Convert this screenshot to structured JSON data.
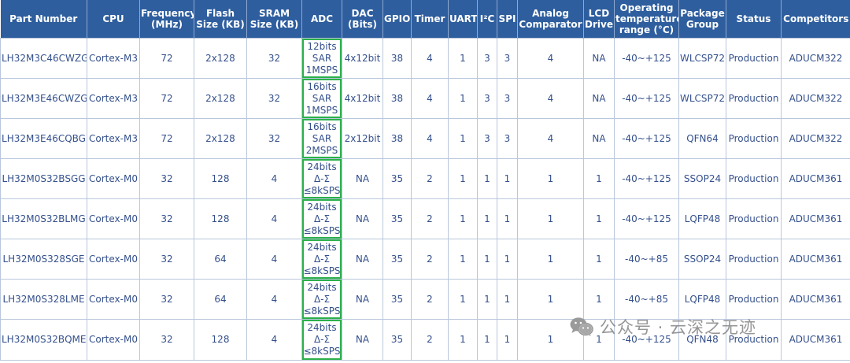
{
  "table": {
    "headers": [
      "Part Number",
      "CPU",
      "Frequency (MHz)",
      "Flash Size (KB)",
      "SRAM Size (KB)",
      "ADC",
      "DAC (Bits)",
      "GPIO",
      "Timer",
      "UART",
      "I²C",
      "SPI",
      "Analog Comparator",
      "LCD Driver",
      "Operating temperature range (°C)",
      "Package Group",
      "Status",
      "Competitors"
    ],
    "rows": [
      [
        "LH32M3C46CWZG",
        "Cortex-M3",
        "72",
        "2x128",
        "32",
        [
          "12bits",
          "SAR",
          "1MSPS"
        ],
        "4x12bit",
        "38",
        "4",
        "1",
        "3",
        "3",
        "4",
        "NA",
        "-40~+125",
        "WLCSP72",
        "Production",
        "ADUCM322"
      ],
      [
        "LH32M3E46CWZG",
        "Cortex-M3",
        "72",
        "2x128",
        "32",
        [
          "16bits",
          "SAR",
          "1MSPS"
        ],
        "4x12bit",
        "38",
        "4",
        "1",
        "3",
        "3",
        "4",
        "NA",
        "-40~+125",
        "WLCSP72",
        "Production",
        "ADUCM322"
      ],
      [
        "LH32M3E46CQBG",
        "Cortex-M3",
        "72",
        "2x128",
        "32",
        [
          "16bits",
          "SAR",
          "2MSPS"
        ],
        "2x12bit",
        "38",
        "4",
        "1",
        "3",
        "3",
        "4",
        "NA",
        "-40~+125",
        "QFN64",
        "Production",
        "ADUCM322"
      ],
      [
        "LH32M0S32BSGG",
        "Cortex-M0",
        "32",
        "128",
        "4",
        [
          "24bits",
          "Δ-Σ",
          "≤8kSPS"
        ],
        "NA",
        "35",
        "2",
        "1",
        "1",
        "1",
        "1",
        "1",
        "-40~+125",
        "SSOP24",
        "Production",
        "ADUCM361"
      ],
      [
        "LH32M0S32BLMG",
        "Cortex-M0",
        "32",
        "128",
        "4",
        [
          "24bits",
          "Δ-Σ",
          "≤8kSPS"
        ],
        "NA",
        "35",
        "2",
        "1",
        "1",
        "1",
        "1",
        "1",
        "-40~+125",
        "LQFP48",
        "Production",
        "ADUCM361"
      ],
      [
        "LH32M0S328SGE",
        "Cortex-M0",
        "32",
        "64",
        "4",
        [
          "24bits",
          "Δ-Σ",
          "≤8kSPS"
        ],
        "NA",
        "35",
        "2",
        "1",
        "1",
        "1",
        "1",
        "1",
        "-40~+85",
        "SSOP24",
        "Production",
        "ADUCM361"
      ],
      [
        "LH32M0S328LME",
        "Cortex-M0",
        "32",
        "64",
        "4",
        [
          "24bits",
          "Δ-Σ",
          "≤8kSPS"
        ],
        "NA",
        "35",
        "2",
        "1",
        "1",
        "1",
        "1",
        "1",
        "-40~+85",
        "LQFP48",
        "Production",
        "ADUCM361"
      ],
      [
        "LH32M0S32BQME",
        "Cortex-M0",
        "32",
        "128",
        "4",
        [
          "24bits",
          "Δ-Σ",
          "≤8kSPS"
        ],
        "NA",
        "35",
        "2",
        "1",
        "1",
        "1",
        "1",
        "1",
        "-40~+125",
        "QFN48",
        "Production",
        "ADUCM361"
      ]
    ],
    "highlighted_column": "ADC",
    "colors": {
      "header_bg": "#2e5e9e",
      "header_text": "#ffffff",
      "cell_text": "#34508c",
      "grid": "#b9c7dc",
      "highlight_border": "#2bb04a"
    }
  },
  "watermark": {
    "icon": "wechat-icon",
    "text": "公众号 · 云深之无迹"
  }
}
